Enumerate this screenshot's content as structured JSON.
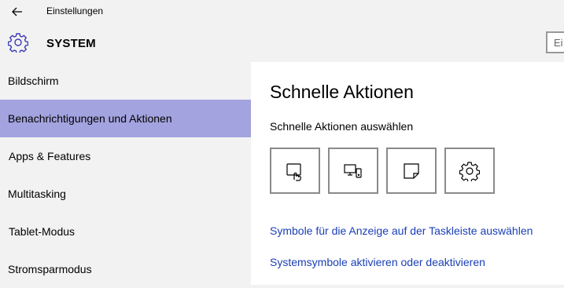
{
  "window": {
    "title": "Einstellungen"
  },
  "header": {
    "section_title": "SYSTEM",
    "search_text": "Ei"
  },
  "sidebar": {
    "items": [
      {
        "label": "Bildschirm",
        "selected": false
      },
      {
        "label": "Benachrichtigungen und Aktionen",
        "selected": true
      },
      {
        "label": "Apps & Features",
        "selected": false
      },
      {
        "label": "Multitasking",
        "selected": false
      },
      {
        "label": "Tablet-Modus",
        "selected": false
      },
      {
        "label": "Stromsparmodus",
        "selected": false
      }
    ]
  },
  "main": {
    "title": "Schnelle Aktionen",
    "subtitle": "Schnelle Aktionen auswählen",
    "quick_actions": [
      {
        "icon": "tablet-mode-icon"
      },
      {
        "icon": "connect-display-icon"
      },
      {
        "icon": "note-icon"
      },
      {
        "icon": "settings-gear-icon"
      }
    ],
    "links": [
      "Symbole für die Anzeige auf der Taskleiste auswählen",
      "Systemsymbole aktivieren oder deaktivieren"
    ]
  },
  "colors": {
    "accent_selected": "#a3a3e0",
    "link": "#1a3fb5",
    "background": "#f2f2f2",
    "icon_accent": "#3a3ab8"
  }
}
